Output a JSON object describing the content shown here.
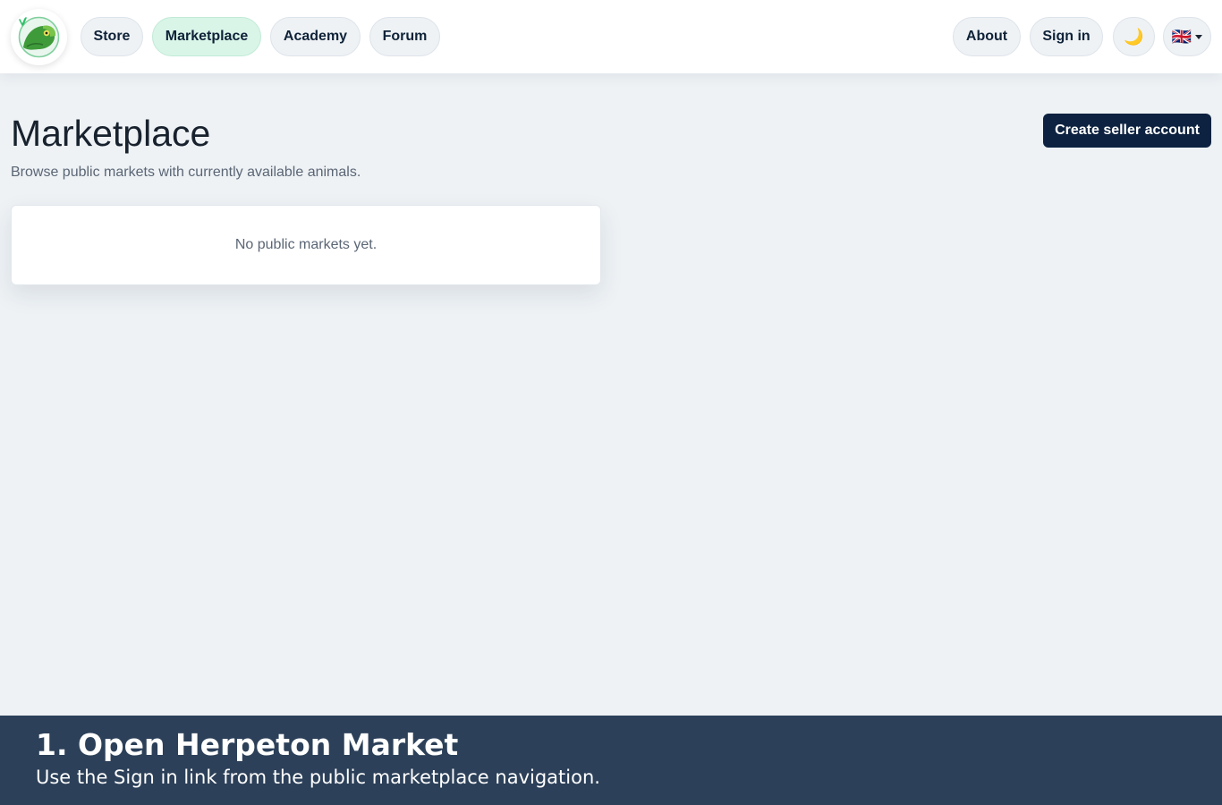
{
  "header": {
    "logo_icon": "chameleon-logo-icon",
    "nav": {
      "store": "Store",
      "marketplace": "Marketplace",
      "academy": "Academy",
      "forum": "Forum"
    },
    "active_nav": "marketplace",
    "about": "About",
    "sign_in": "Sign in",
    "theme_icon": "🌙",
    "language_flag": "🇬🇧"
  },
  "main": {
    "title": "Marketplace",
    "subtitle": "Browse public markets with currently available animals.",
    "create_button": "Create seller account",
    "empty_message": "No public markets yet."
  },
  "caption": {
    "title": "1. Open Herpeton Market",
    "text": "Use the Sign in link from the public marketplace navigation."
  },
  "colors": {
    "background": "#eef2f5",
    "active_nav_bg": "#d9f5e8",
    "primary_button": "#0d2240",
    "caption_bg": "#2c4059"
  }
}
